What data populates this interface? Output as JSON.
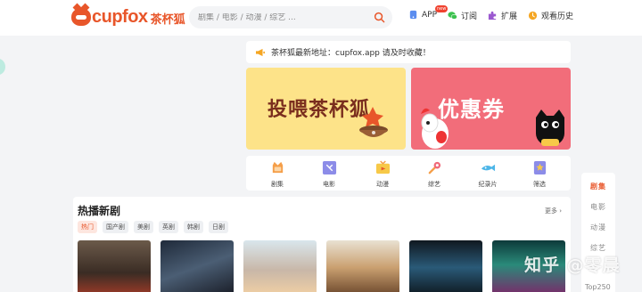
{
  "header": {
    "logo": {
      "text": "cupfox",
      "cn": "茶杯狐"
    },
    "search": {
      "placeholder": "剧集 / 电影 / 动漫 / 综艺 ..."
    },
    "nav": [
      {
        "label": "APP",
        "icon": "app-icon",
        "badge": "new"
      },
      {
        "label": "订阅",
        "icon": "wechat-icon"
      },
      {
        "label": "扩展",
        "icon": "puzzle-icon"
      },
      {
        "label": "观看历史",
        "icon": "history-icon"
      }
    ]
  },
  "notice": {
    "text": "茶杯狐最新地址：cupfox.app 请及时收藏！"
  },
  "banners": [
    {
      "text": "投喂茶杯狐"
    },
    {
      "text": "优惠券"
    }
  ],
  "categories": [
    {
      "label": "剧集",
      "icon": "tv-icon"
    },
    {
      "label": "电影",
      "icon": "film-icon"
    },
    {
      "label": "动漫",
      "icon": "anime-icon"
    },
    {
      "label": "综艺",
      "icon": "variety-icon"
    },
    {
      "label": "纪录片",
      "icon": "documentary-icon"
    },
    {
      "label": "筛选",
      "icon": "filter-icon"
    }
  ],
  "sidebar": {
    "items": [
      "剧集",
      "电影",
      "动漫",
      "综艺"
    ],
    "active": "剧集",
    "top": "Top250"
  },
  "hot_section": {
    "title": "热播新剧",
    "more": "更多",
    "tags": [
      "热门",
      "国产剧",
      "美剧",
      "英剧",
      "韩剧",
      "日剧"
    ],
    "active_tag": "热门"
  },
  "watermark": "知乎 @零晨",
  "colors": {
    "brand": "#e8562a",
    "banner_yellow": "#fde389",
    "banner_pink": "#f26d7a"
  }
}
